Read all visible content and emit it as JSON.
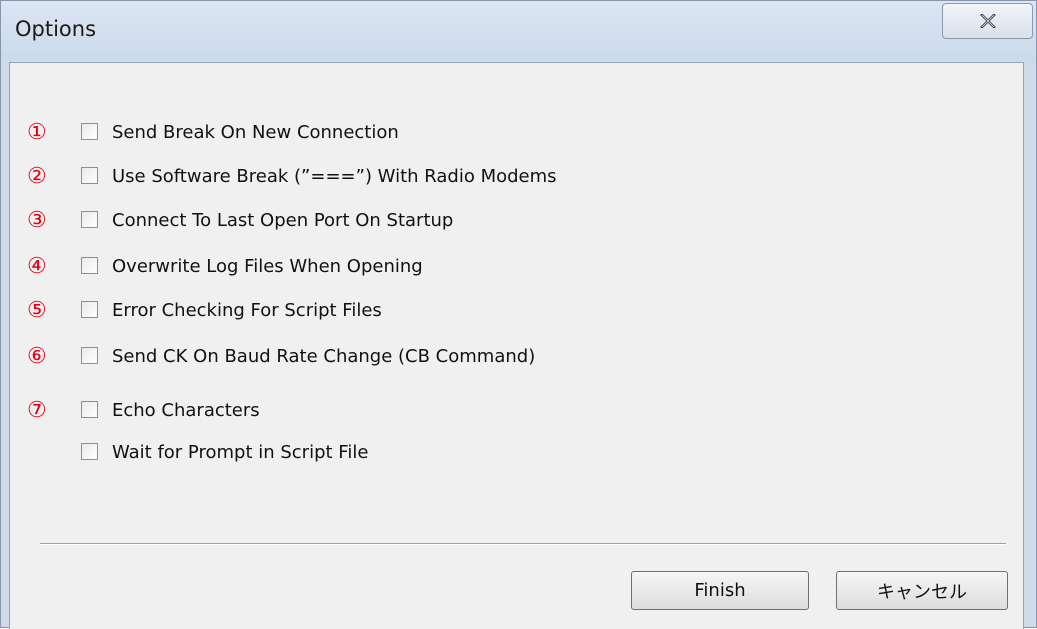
{
  "window": {
    "title": "Options",
    "close_icon": "close-x-icon"
  },
  "options": [
    {
      "marker": "①",
      "label": "Send Break On New Connection",
      "checked": false
    },
    {
      "marker": "②",
      "label": "Use Software Break (”===”) With Radio Modems",
      "checked": false
    },
    {
      "marker": "③",
      "label": "Connect To Last Open Port On Startup",
      "checked": false
    },
    {
      "marker": "④",
      "label": "Overwrite Log Files When Opening",
      "checked": false
    },
    {
      "marker": "⑤",
      "label": "Error Checking For Script Files",
      "checked": false
    },
    {
      "marker": "⑥",
      "label": "Send CK On Baud Rate Change (CB Command)",
      "checked": false
    },
    {
      "marker": "⑦",
      "label": "Echo Characters",
      "checked": false
    },
    {
      "marker": "",
      "label": "Wait for Prompt in Script File",
      "checked": false
    }
  ],
  "buttons": {
    "finish_label": "Finish",
    "cancel_label": "キャンセル"
  },
  "colors": {
    "marker": "#e60012",
    "dialog_bg": "#f0f0f0",
    "frame": "#cfdbe9"
  }
}
